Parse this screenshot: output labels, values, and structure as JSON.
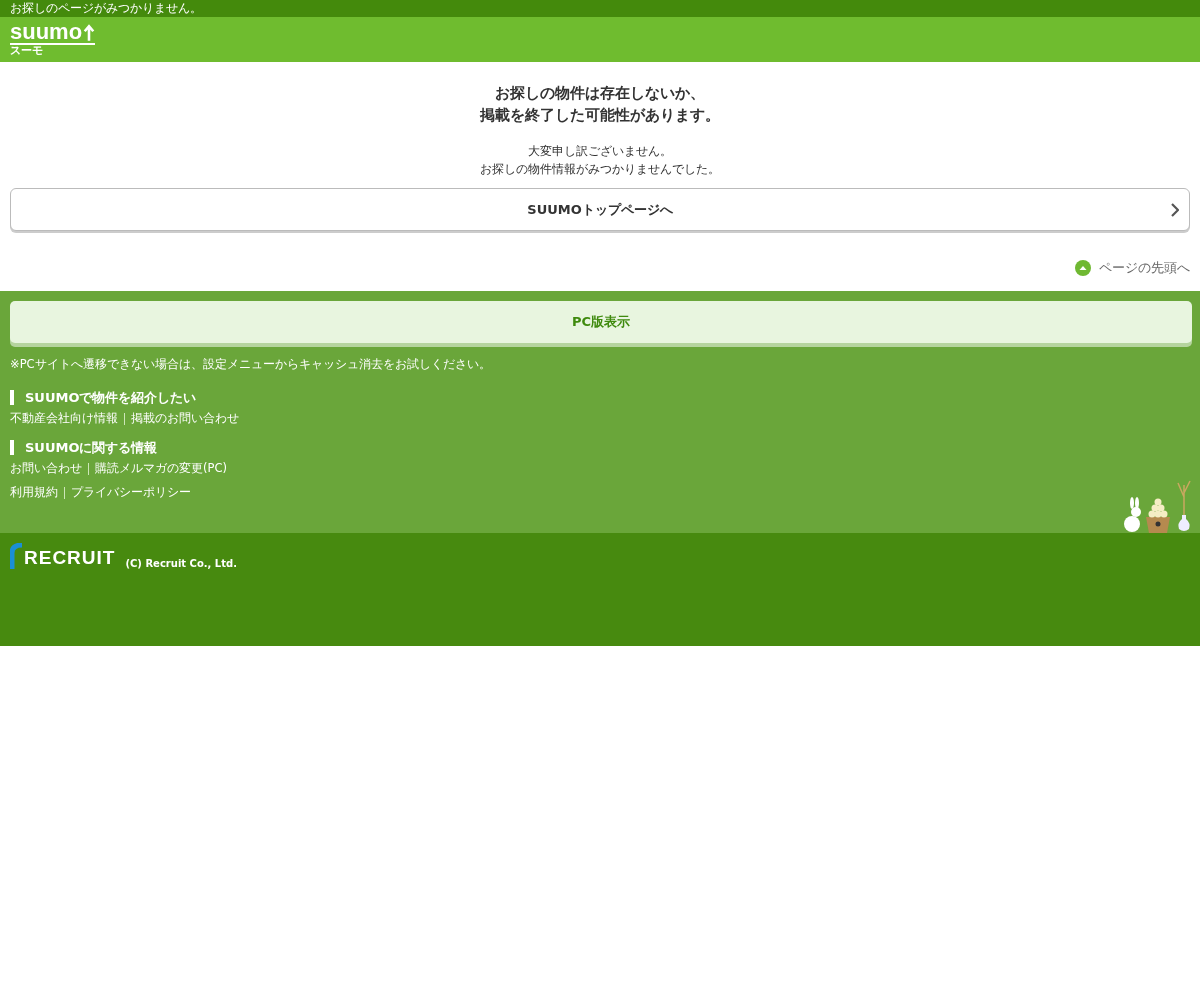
{
  "top_bar": {
    "text": "お探しのページがみつかりません。"
  },
  "header": {
    "logo": "suumo",
    "logo_sub": "スーモ"
  },
  "message": {
    "title_lines": [
      "お探しの物件は存在しないか、",
      "掲載を終了した可能性があります。"
    ],
    "body_lines": [
      "大変申し訳ございません。",
      "お探しの物件情報がみつかりませんでした。"
    ]
  },
  "top_link": {
    "label": "SUUMOトップページへ"
  },
  "page_top": {
    "label": "ページの先頭へ"
  },
  "footer": {
    "pc_button": "PC版表示",
    "note": "※PCサイトへ遷移できない場合は、設定メニューからキャッシュ消去をお試しください。",
    "sections": [
      {
        "heading": "SUUMOで物件を紹介したい",
        "rows": [
          [
            "不動産会社向け情報",
            "掲載のお問い合わせ"
          ]
        ]
      },
      {
        "heading": "SUUMOに関する情報",
        "rows": [
          [
            "お問い合わせ",
            "購読メルマガの変更(PC)"
          ],
          [
            "利用規約",
            "プライバシーポリシー"
          ]
        ]
      }
    ]
  },
  "bottom": {
    "logo": "RECRUIT",
    "copyright": "(C) Recruit Co., Ltd."
  }
}
